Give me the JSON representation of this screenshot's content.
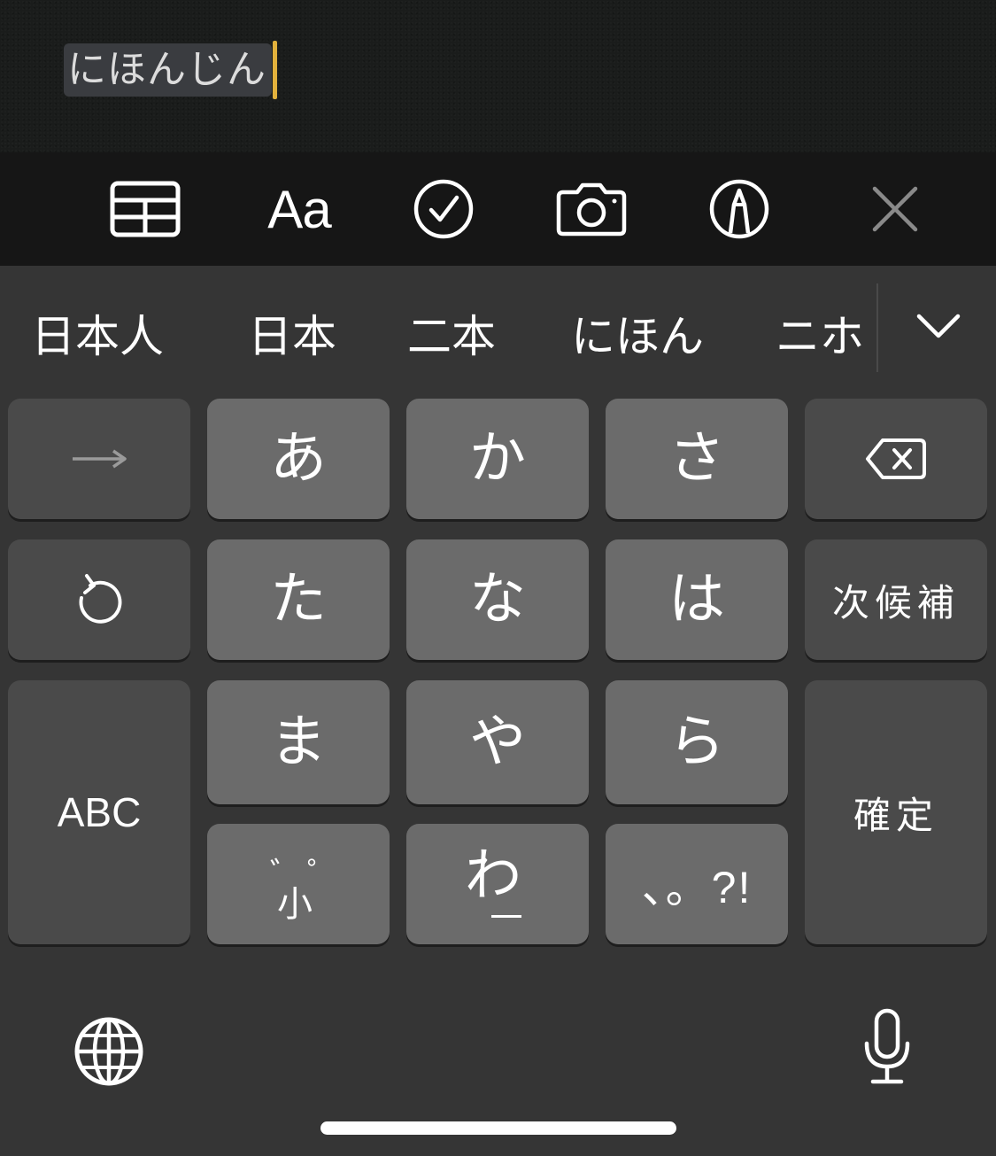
{
  "editor": {
    "marked_text": "にほんじん",
    "caret_color": "#e2b13c"
  },
  "toolbar": {
    "items": [
      {
        "name": "table-icon"
      },
      {
        "name": "text-format",
        "label": "Aa"
      },
      {
        "name": "checklist-icon"
      },
      {
        "name": "camera-icon"
      },
      {
        "name": "markup-pen-icon"
      },
      {
        "name": "close-icon"
      }
    ],
    "format_label": "Aa"
  },
  "candidates": {
    "items": [
      "日本人",
      "日本",
      "二本",
      "にほん",
      "ニホ"
    ],
    "expand_icon": "chevron-down-icon"
  },
  "keyboard": {
    "row1": [
      "→",
      "あ",
      "か",
      "さ",
      "delete"
    ],
    "arrow_label": "→",
    "a": "あ",
    "ka": "か",
    "sa": "さ",
    "ta": "た",
    "na": "な",
    "ha": "は",
    "next_candidate": "次候補",
    "abc": "ABC",
    "ma": "ま",
    "ya": "や",
    "ra": "ら",
    "confirm": "確定",
    "dakuten": "゛ﾞ゜小",
    "dakuten_main": "小",
    "dakuten_top": "゛゜",
    "wa": "わ",
    "wa_sub": "＿",
    "punct": "、。?!"
  },
  "colors": {
    "key_light": "#6b6b6b",
    "key_dark": "#4a4a4a",
    "keyboard_bg": "#353535",
    "toolbar_bg": "#161616"
  }
}
